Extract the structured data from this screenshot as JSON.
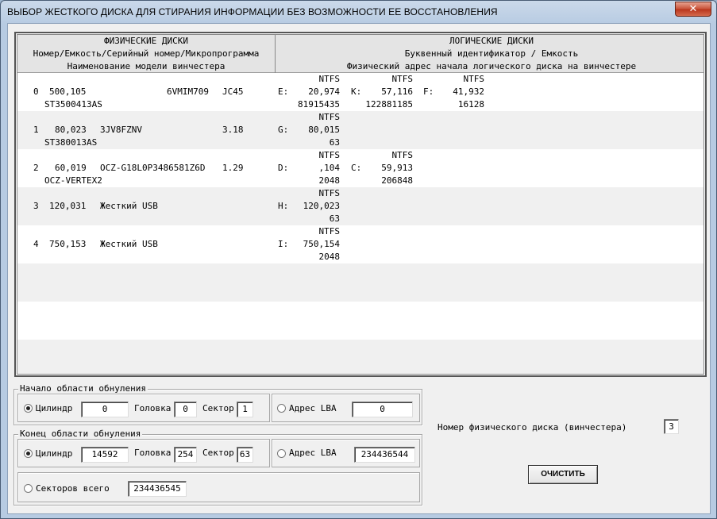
{
  "window": {
    "title": "ВЫБОР ЖЕСТКОГО ДИСКА ДЛЯ СТИРАНИЯ ИНФОРМАЦИИ БЕЗ ВОЗМОЖНОСТИ ЕЕ ВОССТАНОВЛЕНИЯ",
    "close_label": "✕"
  },
  "table": {
    "physical_header": [
      "ФИЗИЧЕСКИЕ ДИСКИ",
      "Номер/Емкость/Серийный номер/Микропрограмма",
      "Наименование модели винчестера"
    ],
    "logical_header": [
      "ЛОГИЧЕСКИЕ ДИСКИ",
      "Буквенный идентификатор / Емкость",
      "Физический адрес начала логического диска на винчестере"
    ],
    "rows": [
      {
        "num": "0",
        "size": "500,105",
        "serial": "6VMIM709",
        "fw": "JC45",
        "model": "ST3500413AS",
        "logical": [
          {
            "fs": "NTFS",
            "letter": "E:",
            "cap": "20,974",
            "addr": "81915435"
          },
          {
            "fs": "NTFS",
            "letter": "K:",
            "cap": "57,116",
            "addr": "122881185"
          },
          {
            "fs": "NTFS",
            "letter": "F:",
            "cap": "41,932",
            "addr": "16128"
          }
        ]
      },
      {
        "num": "1",
        "size": "80,023",
        "serial": "3JV8FZNV",
        "fw": "3.18",
        "model": "ST380013AS",
        "logical": [
          {
            "fs": "NTFS",
            "letter": "G:",
            "cap": "80,015",
            "addr": "63"
          }
        ]
      },
      {
        "num": "2",
        "size": "60,019",
        "serial": "OCZ-G18L0P3486581Z6D",
        "fw": "1.29",
        "model": "OCZ-VERTEX2",
        "logical": [
          {
            "fs": "NTFS",
            "letter": "D:",
            "cap": ",104",
            "addr": "2048"
          },
          {
            "fs": "NTFS",
            "letter": "C:",
            "cap": "59,913",
            "addr": "206848"
          }
        ]
      },
      {
        "num": "3",
        "size": "120,031",
        "serial": "Жесткий USB",
        "fw": "",
        "model": "",
        "logical": [
          {
            "fs": "NTFS",
            "letter": "H:",
            "cap": "120,023",
            "addr": "63"
          }
        ]
      },
      {
        "num": "4",
        "size": "750,153",
        "serial": "Жесткий USB",
        "fw": "",
        "model": "",
        "logical": [
          {
            "fs": "NTFS",
            "letter": "I:",
            "cap": "750,154",
            "addr": "2048"
          }
        ]
      }
    ]
  },
  "start_group": {
    "title": "Начало области обнуления",
    "cylinder_label": "Цилиндр",
    "cylinder_value": "0",
    "head_label": "Головка",
    "head_value": "0",
    "sector_label": "Сектор",
    "sector_value": "1",
    "lba_label": "Адрес LBA",
    "lba_value": "0"
  },
  "end_group": {
    "title": "Конец области обнуления",
    "cylinder_label": "Цилиндр",
    "cylinder_value": "14592",
    "head_label": "Головка",
    "head_value": "254",
    "sector_label": "Сектор",
    "sector_value": "63",
    "lba_label": "Адрес LBA",
    "lba_value": "234436544",
    "sectors_label": "Секторов всего",
    "sectors_value": "234436545"
  },
  "disk_number": {
    "label": "Номер физического диска (винчестера)",
    "value": "3"
  },
  "clear_button": "ОЧИСТИТЬ"
}
